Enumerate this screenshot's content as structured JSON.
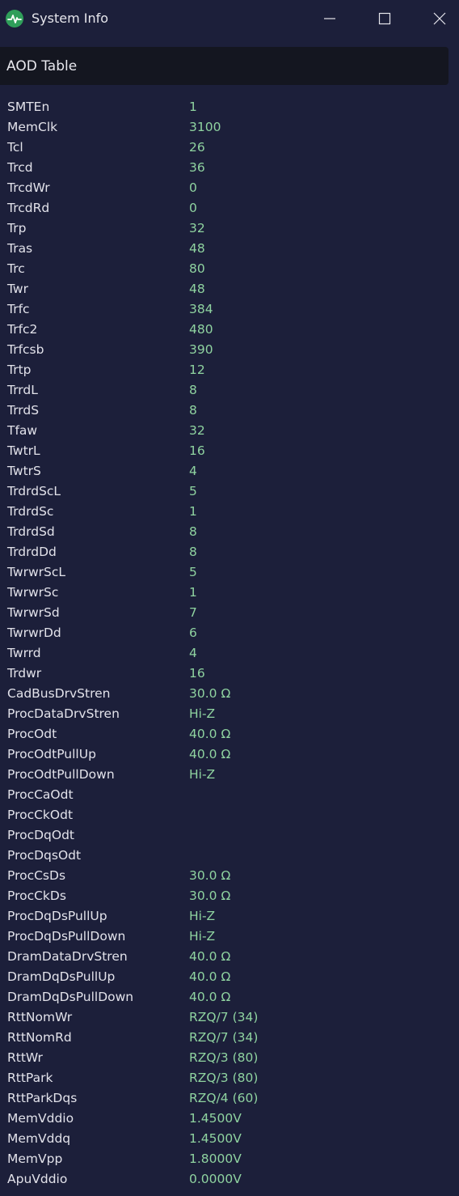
{
  "window": {
    "title": "System Info",
    "controls": [
      "minimize",
      "maximize",
      "close"
    ]
  },
  "section": {
    "title": "AOD Table"
  },
  "colors": {
    "background": "#1c1f3a",
    "header_background": "#141620",
    "key_text": "#e2e2ea",
    "value_text": "#8fd3a0",
    "app_icon": "#2f9e5a"
  },
  "rows": [
    {
      "key": "SMTEn",
      "value": "1"
    },
    {
      "key": "MemClk",
      "value": "3100"
    },
    {
      "key": "Tcl",
      "value": "26"
    },
    {
      "key": "Trcd",
      "value": "36"
    },
    {
      "key": "TrcdWr",
      "value": "0"
    },
    {
      "key": "TrcdRd",
      "value": "0"
    },
    {
      "key": "Trp",
      "value": "32"
    },
    {
      "key": "Tras",
      "value": "48"
    },
    {
      "key": "Trc",
      "value": "80"
    },
    {
      "key": "Twr",
      "value": "48"
    },
    {
      "key": "Trfc",
      "value": "384"
    },
    {
      "key": "Trfc2",
      "value": "480"
    },
    {
      "key": "Trfcsb",
      "value": "390"
    },
    {
      "key": "Trtp",
      "value": "12"
    },
    {
      "key": "TrrdL",
      "value": "8"
    },
    {
      "key": "TrrdS",
      "value": "8"
    },
    {
      "key": "Tfaw",
      "value": "32"
    },
    {
      "key": "TwtrL",
      "value": "16"
    },
    {
      "key": "TwtrS",
      "value": "4"
    },
    {
      "key": "TrdrdScL",
      "value": "5"
    },
    {
      "key": "TrdrdSc",
      "value": "1"
    },
    {
      "key": "TrdrdSd",
      "value": "8"
    },
    {
      "key": "TrdrdDd",
      "value": "8"
    },
    {
      "key": "TwrwrScL",
      "value": "5"
    },
    {
      "key": "TwrwrSc",
      "value": "1"
    },
    {
      "key": "TwrwrSd",
      "value": "7"
    },
    {
      "key": "TwrwrDd",
      "value": "6"
    },
    {
      "key": "Twrrd",
      "value": "4"
    },
    {
      "key": "Trdwr",
      "value": "16"
    },
    {
      "key": "CadBusDrvStren",
      "value": "30.0 Ω"
    },
    {
      "key": "ProcDataDrvStren",
      "value": "Hi-Z"
    },
    {
      "key": "ProcOdt",
      "value": "40.0 Ω"
    },
    {
      "key": "ProcOdtPullUp",
      "value": "40.0 Ω"
    },
    {
      "key": "ProcOdtPullDown",
      "value": "Hi-Z"
    },
    {
      "key": "ProcCaOdt",
      "value": ""
    },
    {
      "key": "ProcCkOdt",
      "value": ""
    },
    {
      "key": "ProcDqOdt",
      "value": ""
    },
    {
      "key": "ProcDqsOdt",
      "value": ""
    },
    {
      "key": "ProcCsDs",
      "value": "30.0 Ω"
    },
    {
      "key": "ProcCkDs",
      "value": "30.0 Ω"
    },
    {
      "key": "ProcDqDsPullUp",
      "value": "Hi-Z"
    },
    {
      "key": "ProcDqDsPullDown",
      "value": "Hi-Z"
    },
    {
      "key": "DramDataDrvStren",
      "value": "40.0 Ω"
    },
    {
      "key": "DramDqDsPullUp",
      "value": "40.0 Ω"
    },
    {
      "key": "DramDqDsPullDown",
      "value": "40.0 Ω"
    },
    {
      "key": "RttNomWr",
      "value": "RZQ/7 (34)"
    },
    {
      "key": "RttNomRd",
      "value": "RZQ/7 (34)"
    },
    {
      "key": "RttWr",
      "value": "RZQ/3 (80)"
    },
    {
      "key": "RttPark",
      "value": "RZQ/3 (80)"
    },
    {
      "key": "RttParkDqs",
      "value": "RZQ/4 (60)"
    },
    {
      "key": "MemVddio",
      "value": "1.4500V"
    },
    {
      "key": "MemVddq",
      "value": "1.4500V"
    },
    {
      "key": "MemVpp",
      "value": "1.8000V"
    },
    {
      "key": "ApuVddio",
      "value": "0.0000V"
    }
  ]
}
